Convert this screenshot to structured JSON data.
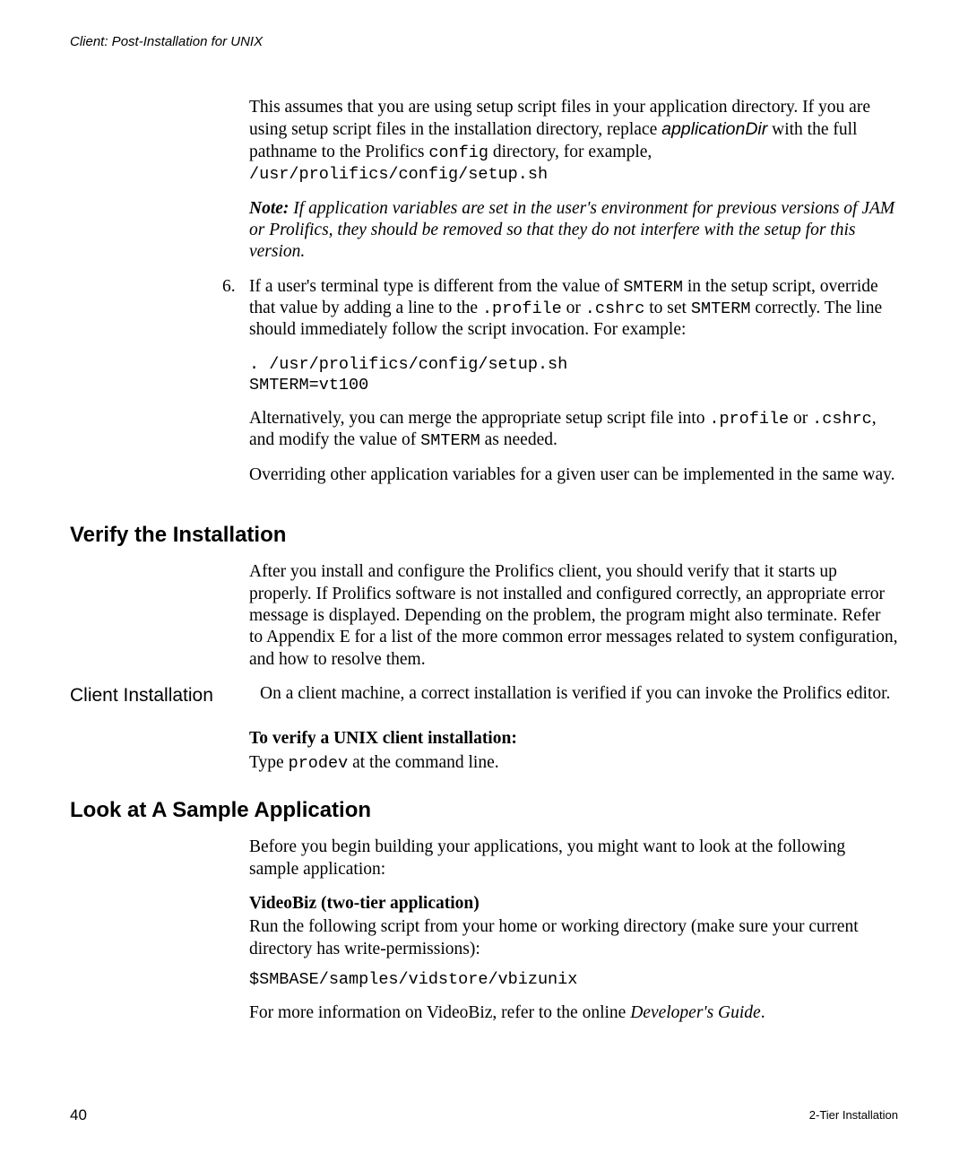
{
  "header": "Client: Post-Installation for UNIX",
  "intro": {
    "p1_a": "This assumes that you are using setup script files in your application directory. If you are using setup script files in the installation directory, replace ",
    "p1_b": "applicationDir",
    "p1_c": " with the full pathname to the Prolifics ",
    "p1_d": "config",
    "p1_e": " directory, for example, ",
    "p1_f": "/usr/prolifics/config/setup.sh",
    "note_a": "Note:",
    "note_b": "  If application variables are set in the user's environment for previous versions of JAM or Prolifics, they should be removed so that they do not interfere with the setup for this version."
  },
  "step6": {
    "num": "6.",
    "a": "If a user's terminal type is different from the value of ",
    "b": "SMTERM",
    "c": " in the setup script, override that value by adding a line to the ",
    "d": ".profile",
    "e": " or ",
    "f": ".cshrc",
    "g": " to set ",
    "h": "SMTERM",
    "i": " correctly. The line should immediately follow the script invocation. For example:",
    "code": ". /usr/prolifics/config/setup.sh\nSMTERM=vt100",
    "alt_a": "Alternatively, you can merge the appropriate setup script file into ",
    "alt_b": ".profile",
    "alt_c": " or ",
    "alt_d": ".cshrc",
    "alt_e": ", and modify the value of ",
    "alt_f": "SMTERM",
    "alt_g": " as needed.",
    "over": "Overriding other application variables for a given user can be implemented in the same way."
  },
  "verify": {
    "h": "Verify the Installation",
    "p1": "After you install and configure the Prolifics client, you should verify that it starts up properly. If Prolifics software is not installed and configured correctly, an appropriate error message is displayed. Depending on the problem, the program might also terminate. Refer to Appendix E for a list of the more common error messages related to system configuration, and how to resolve them.",
    "side": "Client Installation",
    "p2": "On a client machine, a correct installation is verified if you can invoke the Prolifics editor.",
    "p3h": "To verify a UNIX client installation:",
    "p3a": "Type ",
    "p3b": "prodev",
    "p3c": " at the command line."
  },
  "sample": {
    "h": "Look at A Sample Application",
    "p1": "Before you begin building your applications, you might want to look at the following sample application:",
    "p2h": "VideoBiz (two-tier application)",
    "p2": "Run the following script from your home or working directory (make sure your current directory has write-permissions):",
    "code": "$SMBASE/samples/vidstore/vbizunix",
    "p3a": "For more information on VideoBiz, refer to the online ",
    "p3b": "Developer's Guide",
    "p3c": "."
  },
  "footer": {
    "page": "40",
    "title": "2-Tier Installation"
  }
}
